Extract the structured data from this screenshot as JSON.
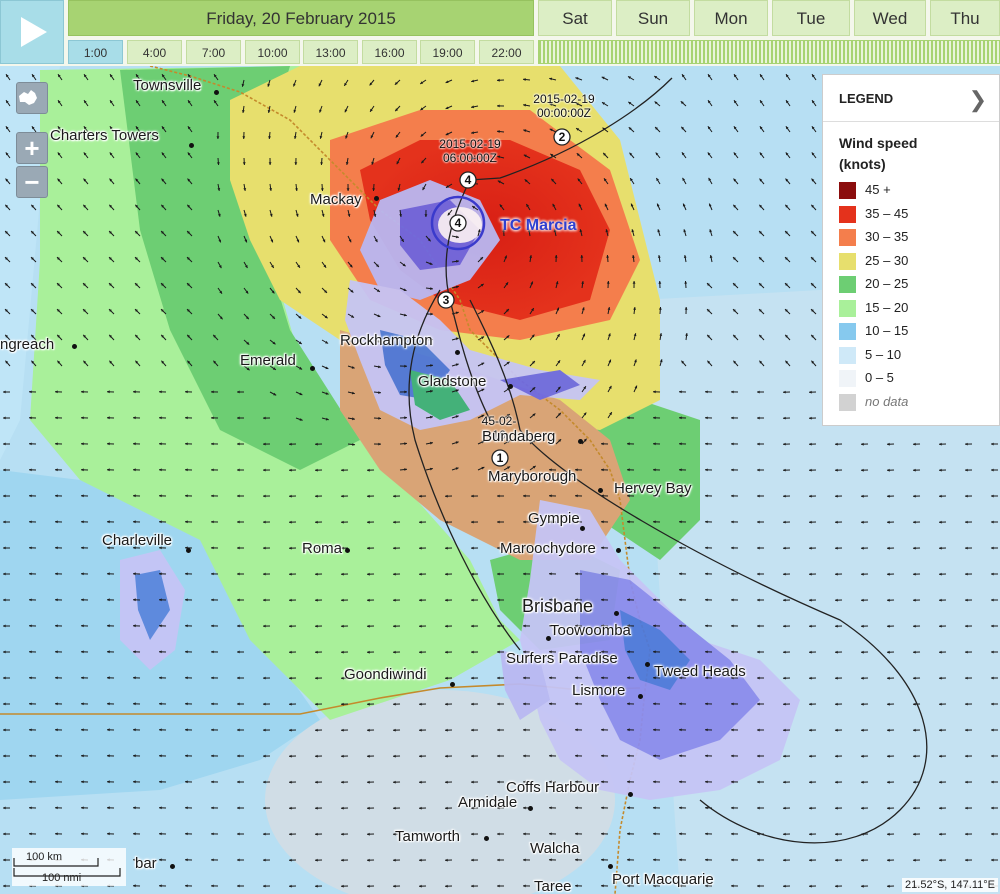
{
  "toolbar": {
    "date": "Friday, 20 February 2015",
    "days": [
      "Sat",
      "Sun",
      "Mon",
      "Tue",
      "Wed",
      "Thu"
    ],
    "hours": [
      "1:00",
      "4:00",
      "7:00",
      "10:00",
      "13:00",
      "16:00",
      "19:00",
      "22:00"
    ],
    "active_hour": "1:00"
  },
  "map": {
    "cities": {
      "townsville": "Townsville",
      "charters_towers": "Charters Towers",
      "mackay": "Mackay",
      "longreach": "ngreach",
      "emerald": "Emerald",
      "rockhampton": "Rockhampton",
      "gladstone": "Gladstone",
      "bundaberg": "Bundaberg",
      "maryborough": "Maryborough",
      "hervey_bay": "Hervey Bay",
      "gympie": "Gympie",
      "charleville": "Charleville",
      "roma": "Roma",
      "maroochydore": "Maroochydore",
      "brisbane": "Brisbane",
      "toowoomba": "Toowoomba",
      "surfers_paradise": "Surfers Paradise",
      "tweed_heads": "Tweed Heads",
      "goondiwindi": "Goondiwindi",
      "lismore": "Lismore",
      "coffs_harbour": "Coffs Harbour",
      "armidale": "Armidale",
      "tamworth": "Tamworth",
      "walcha": "Walcha",
      "cobar": "bar",
      "port_macquarie": "Port Macquarie",
      "taree": "Taree"
    },
    "cyclone": {
      "name": "TC Marcia",
      "track_points": [
        {
          "label": "2015-02-19 00:00:00Z",
          "category": "2"
        },
        {
          "label": "2015-02-19 06:00:00Z",
          "category": "4"
        },
        {
          "label": "",
          "category": "4"
        },
        {
          "label": "",
          "category": "3"
        },
        {
          "label": "45-02- 16",
          "category": "1"
        }
      ]
    },
    "scale": {
      "km": "100 km",
      "nmi": "100 nmi"
    },
    "coordinates": "21.52°S, 147.11°E"
  },
  "legend": {
    "title": "LEGEND",
    "subtitle_line1": "Wind speed",
    "subtitle_line2": "(knots)",
    "items": [
      {
        "label": "45 +",
        "color": "#8b0d0d"
      },
      {
        "label": "35 – 45",
        "color": "#e4321c"
      },
      {
        "label": "30 – 35",
        "color": "#f47e4c"
      },
      {
        "label": "25 – 30",
        "color": "#e7df6d"
      },
      {
        "label": "20 – 25",
        "color": "#6dce73"
      },
      {
        "label": "15 – 20",
        "color": "#a9f09a"
      },
      {
        "label": "10 – 15",
        "color": "#86c9ee"
      },
      {
        "label": "5 – 10",
        "color": "#cfe9f8"
      },
      {
        "label": "0 – 5",
        "color": "#f0f4f8"
      },
      {
        "label": "no data",
        "color": "#d2d2d2"
      }
    ]
  }
}
